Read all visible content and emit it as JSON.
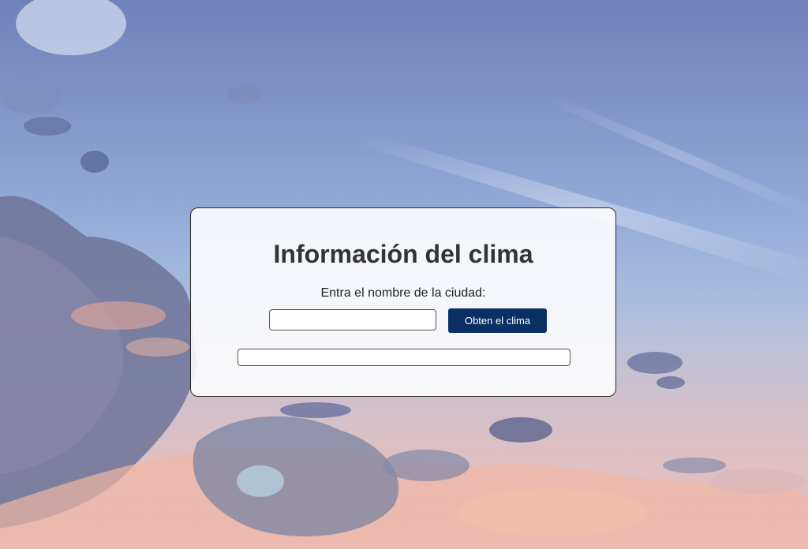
{
  "app": {
    "title": "Información del clima"
  },
  "form": {
    "city_label": "Entra el nombre de la ciudad:",
    "city_input_value": "",
    "city_input_placeholder": "",
    "submit_label": "Obten el clima"
  },
  "result": {
    "text": ""
  },
  "colors": {
    "button_bg": "#0a2f63",
    "button_text": "#ffffff",
    "title_text": "#333333"
  }
}
